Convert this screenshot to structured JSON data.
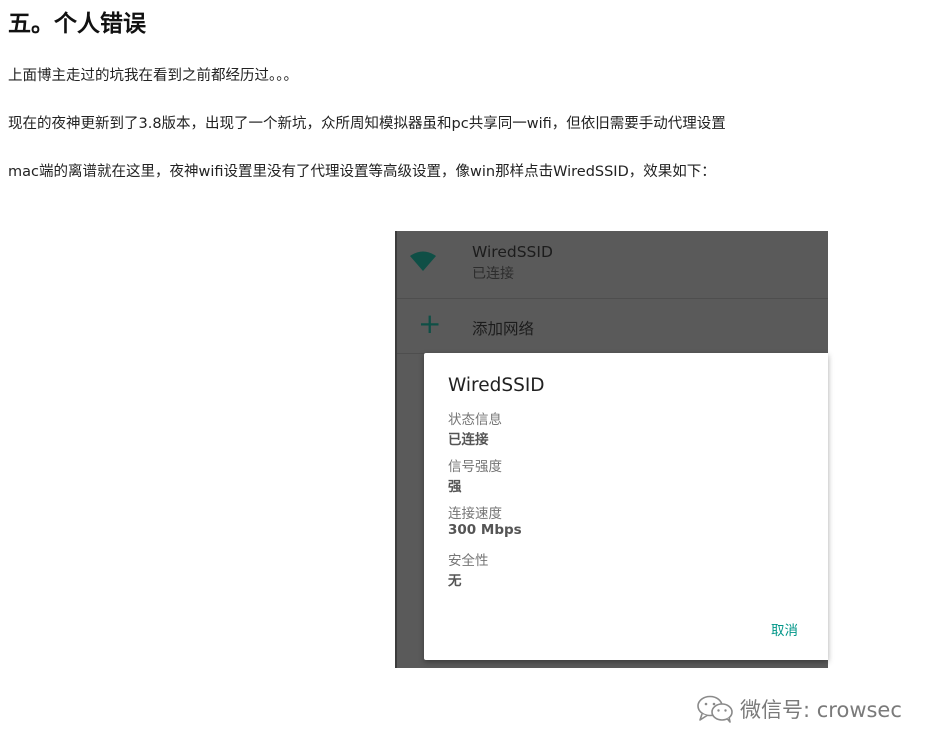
{
  "article": {
    "heading": "五。个人错误",
    "paragraphs": [
      "上面博主走过的坑我在看到之前都经历过。。。",
      "现在的夜神更新到了3.8版本，出现了一个新坑，众所周知模拟器虽和pc共享同一wifi，但依旧需要手动代理设置",
      "mac端的离谱就在这里，夜神wifi设置里没有了代理设置等高级设置，像win那样点击WiredSSID，效果如下："
    ]
  },
  "emulator": {
    "network": {
      "name": "WiredSSID",
      "status": "已连接",
      "icon": "wifi-icon"
    },
    "add_network": {
      "label": "添加网络",
      "icon": "plus-icon"
    },
    "dialog": {
      "title": "WiredSSID",
      "fields": [
        {
          "label": "状态信息",
          "value": "已连接"
        },
        {
          "label": "信号强度",
          "value": "强"
        },
        {
          "label": "连接速度",
          "value": "300 Mbps"
        },
        {
          "label": "安全性",
          "value": "无"
        }
      ],
      "cancel_label": "取消"
    }
  },
  "watermark": {
    "text": "微信号: crowsec",
    "icon": "wechat-icon"
  },
  "colors": {
    "accent": "#009688",
    "overlay": "#5a5a5a",
    "wifi_icon": "#0f4f46"
  }
}
